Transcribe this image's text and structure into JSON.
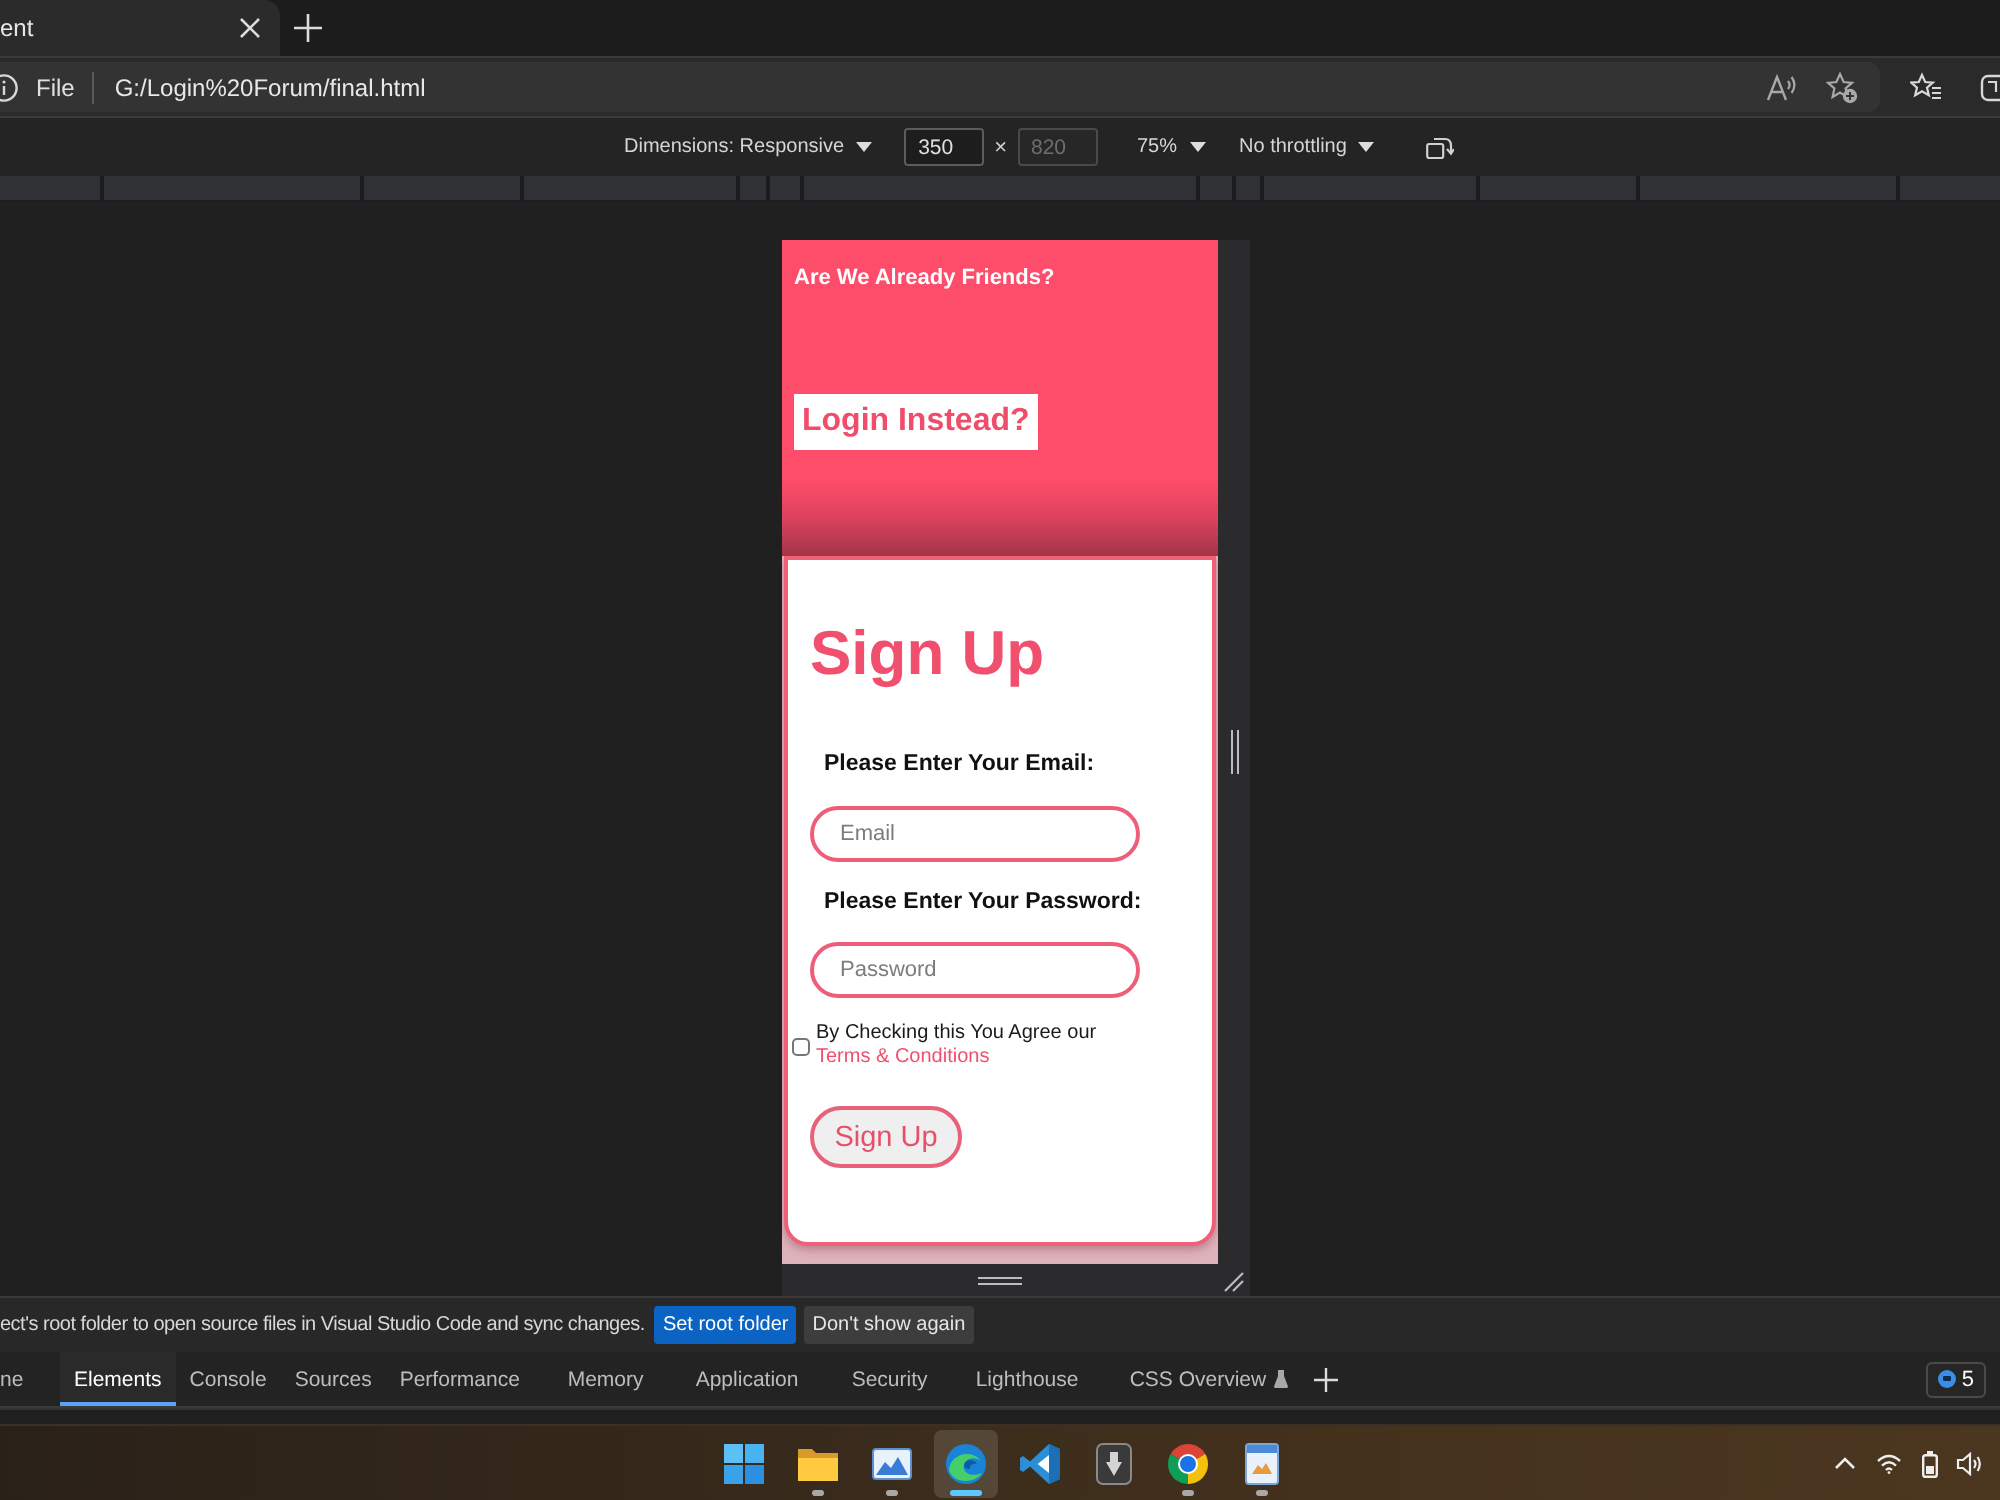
{
  "browser_tab": {
    "title": "ent"
  },
  "address_bar": {
    "scheme": "File",
    "url": "G:/Login%20Forum/final.html"
  },
  "device_toolbar": {
    "dimensions": "Dimensions: Responsive",
    "width": {
      "value": "350",
      "disabled": false
    },
    "times": "×",
    "height": {
      "value": "820",
      "disabled": true
    },
    "zoom": "75%",
    "throttling": "No throttling"
  },
  "page": {
    "banner_text": "Are We Already Friends?",
    "login_button": "Login Instead?",
    "heading": "Sign Up",
    "fields": [
      {
        "label": "Please Enter Your Email:",
        "placeholder": "Email"
      },
      {
        "label": "Please Enter Your Password:",
        "placeholder": "Password"
      }
    ],
    "terms": {
      "checked": false,
      "text": "By Checking this You Agree our",
      "link": "Terms & Conditions"
    },
    "submit_button": "Sign Up"
  },
  "notification": {
    "text": "ect's root folder to open source files in Visual Studio Code and sync changes.",
    "buttons": [
      {
        "label": "Set root folder",
        "kind": "primary"
      },
      {
        "label": "Don't show again",
        "kind": "secondary"
      }
    ]
  },
  "devtools_tabs": [
    {
      "label": "ne",
      "selected": false,
      "experimental": false
    },
    {
      "label": "Elements",
      "selected": true,
      "experimental": false
    },
    {
      "label": "Console",
      "selected": false,
      "experimental": false
    },
    {
      "label": "Sources",
      "selected": false,
      "experimental": false
    },
    {
      "label": "Performance",
      "selected": false,
      "experimental": false
    },
    {
      "label": "Memory",
      "selected": false,
      "experimental": false
    },
    {
      "label": "Application",
      "selected": false,
      "experimental": false
    },
    {
      "label": "Security",
      "selected": false,
      "experimental": false
    },
    {
      "label": "Lighthouse",
      "selected": false,
      "experimental": false
    },
    {
      "label": "CSS Overview",
      "selected": false,
      "experimental": true
    }
  ],
  "issues_count": "5",
  "taskbar": {
    "apps": [
      {
        "kind": "grid",
        "running": false,
        "selected": false
      },
      {
        "kind": "folder",
        "running": true,
        "selected": false
      },
      {
        "kind": "picture",
        "running": true,
        "selected": false
      },
      {
        "kind": "swirl",
        "running": true,
        "selected": true
      },
      {
        "kind": "code",
        "running": false,
        "selected": false
      },
      {
        "kind": "tile",
        "running": false,
        "selected": false
      },
      {
        "kind": "wheel",
        "running": true,
        "selected": false
      },
      {
        "kind": "document",
        "running": true,
        "selected": false
      }
    ]
  }
}
